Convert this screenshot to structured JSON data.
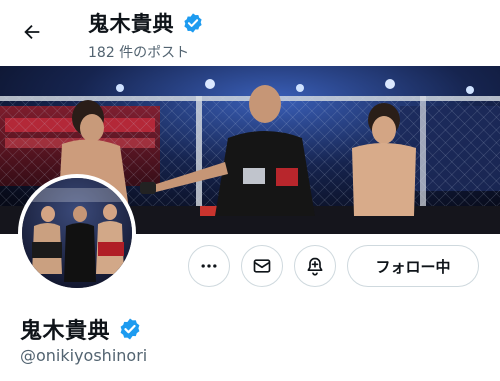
{
  "header": {
    "title": "鬼木貴典",
    "post_count": "182 件のポスト"
  },
  "profile": {
    "display_name": "鬼木貴典",
    "handle": "@onikiyoshinori",
    "verified": true
  },
  "actions": {
    "follow_label": "フォロー中"
  },
  "icons": {
    "back": "arrow-left-icon",
    "verified": "verified-badge-icon",
    "more": "more-horizontal-icon",
    "message": "envelope-icon",
    "notify": "bell-plus-icon"
  },
  "colors": {
    "verified_blue": "#1d9bf0",
    "text_primary": "#0f1419",
    "text_secondary": "#536471",
    "border": "#cfd9de"
  }
}
